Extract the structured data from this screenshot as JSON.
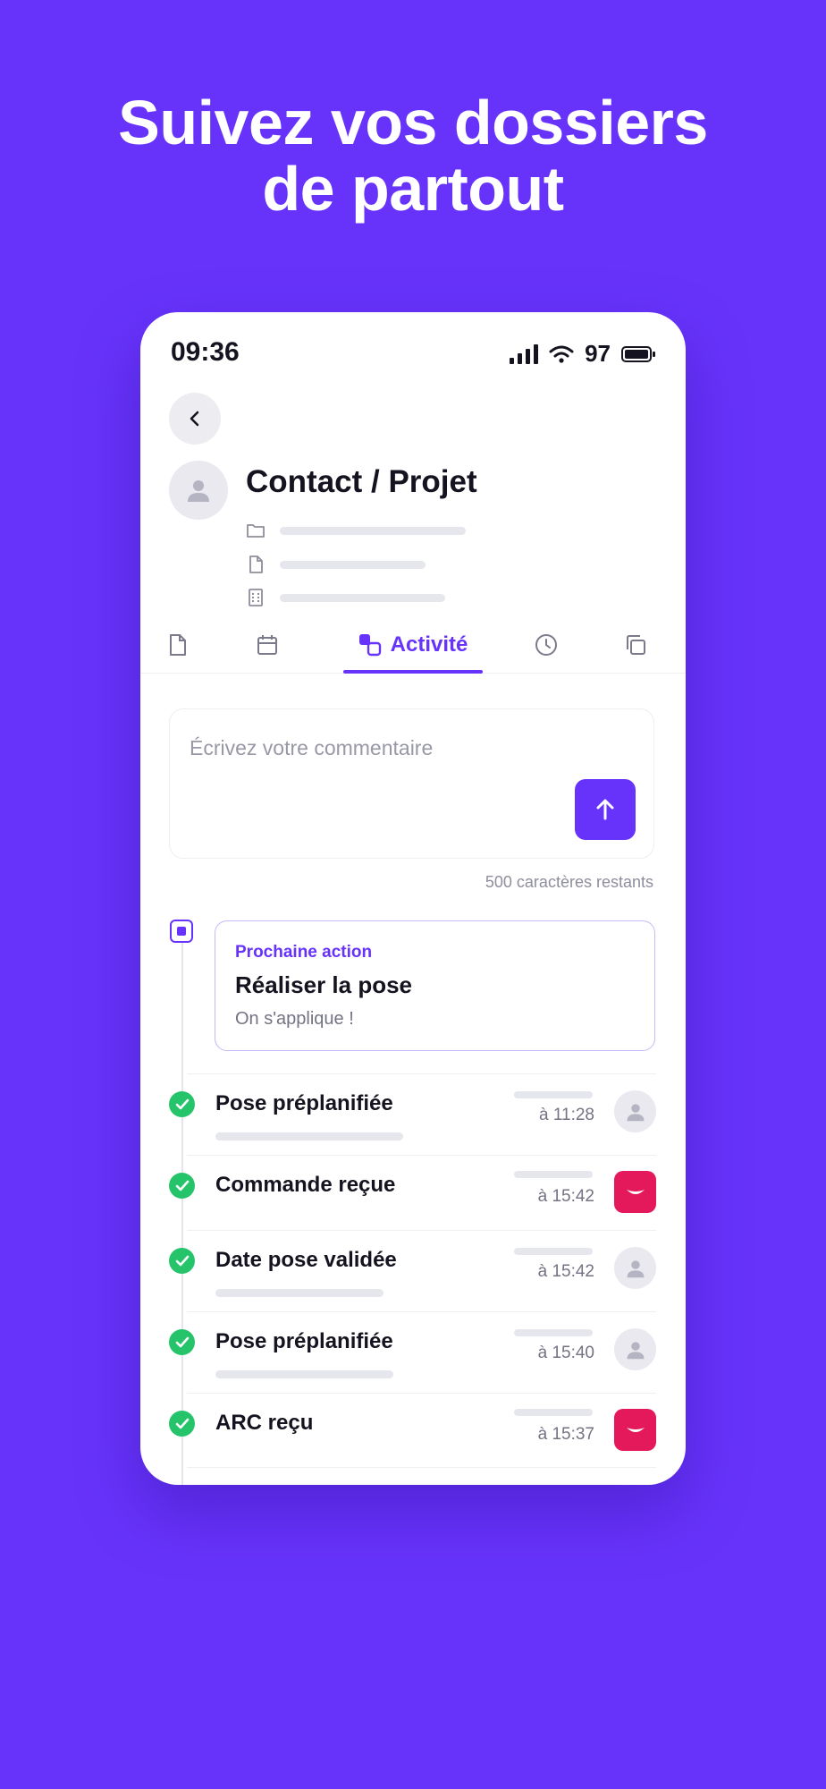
{
  "headline": {
    "line1": "Suivez vos dossiers",
    "line2": "de partout"
  },
  "status_bar": {
    "time": "09:36",
    "battery": "97"
  },
  "header": {
    "title": "Contact / Projet"
  },
  "tabs": [
    {
      "icon": "document-icon"
    },
    {
      "icon": "calendar-icon"
    },
    {
      "icon": "activity-icon",
      "label": "Activité",
      "active": true
    },
    {
      "icon": "clock-icon"
    },
    {
      "icon": "copy-icon"
    }
  ],
  "comment": {
    "placeholder": "Écrivez votre commentaire",
    "chars_left": "500 caractères restants"
  },
  "next_action": {
    "label": "Prochaine action",
    "title": "Réaliser la pose",
    "subtitle": "On s'applique !"
  },
  "events": [
    {
      "title": "Pose préplanifiée",
      "time": "à 11:28",
      "actor": "user-avatar"
    },
    {
      "title": "Commande reçue",
      "time": "à 15:42",
      "actor": "brand-logo"
    },
    {
      "title": "Date pose validée",
      "time": "à 15:42",
      "actor": "user-avatar"
    },
    {
      "title": "Pose préplanifiée",
      "time": "à 15:40",
      "actor": "user-avatar"
    },
    {
      "title": "ARC reçu",
      "time": "à 15:37",
      "actor": "brand-logo"
    }
  ],
  "colors": {
    "background": "#6733FB",
    "accent": "#6733FB",
    "success": "#25C46B",
    "brand": "#E3195B"
  }
}
